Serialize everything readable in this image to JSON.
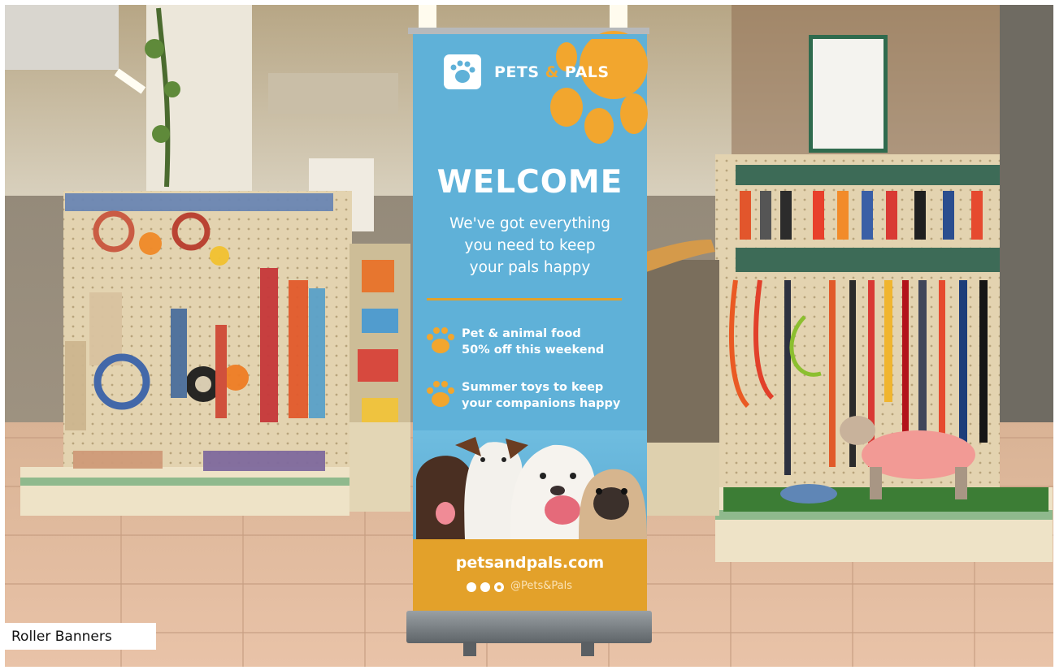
{
  "banner": {
    "brand_prefix": "PETS",
    "brand_amp": "&",
    "brand_suffix": "PALS",
    "headline": "WELCOME",
    "tagline_lines": [
      "We've got everything",
      "you need to keep",
      "your pals happy"
    ],
    "promos": [
      {
        "line1": "Pet & animal food",
        "line2": "50% off this weekend",
        "icon": "paw-icon"
      },
      {
        "line1": "Summer toys to keep",
        "line2": "your companions happy",
        "icon": "paw-icon"
      }
    ],
    "website": "petsandpals.com",
    "social_handle": "@Pets&Pals",
    "social_icons": [
      "facebook-icon",
      "twitter-icon",
      "instagram-icon"
    ]
  },
  "caption": "Roller Banners",
  "colors": {
    "banner_blue": "#5fb1d8",
    "accent_orange": "#f2a62e",
    "footer_orange": "#e3a12a"
  }
}
